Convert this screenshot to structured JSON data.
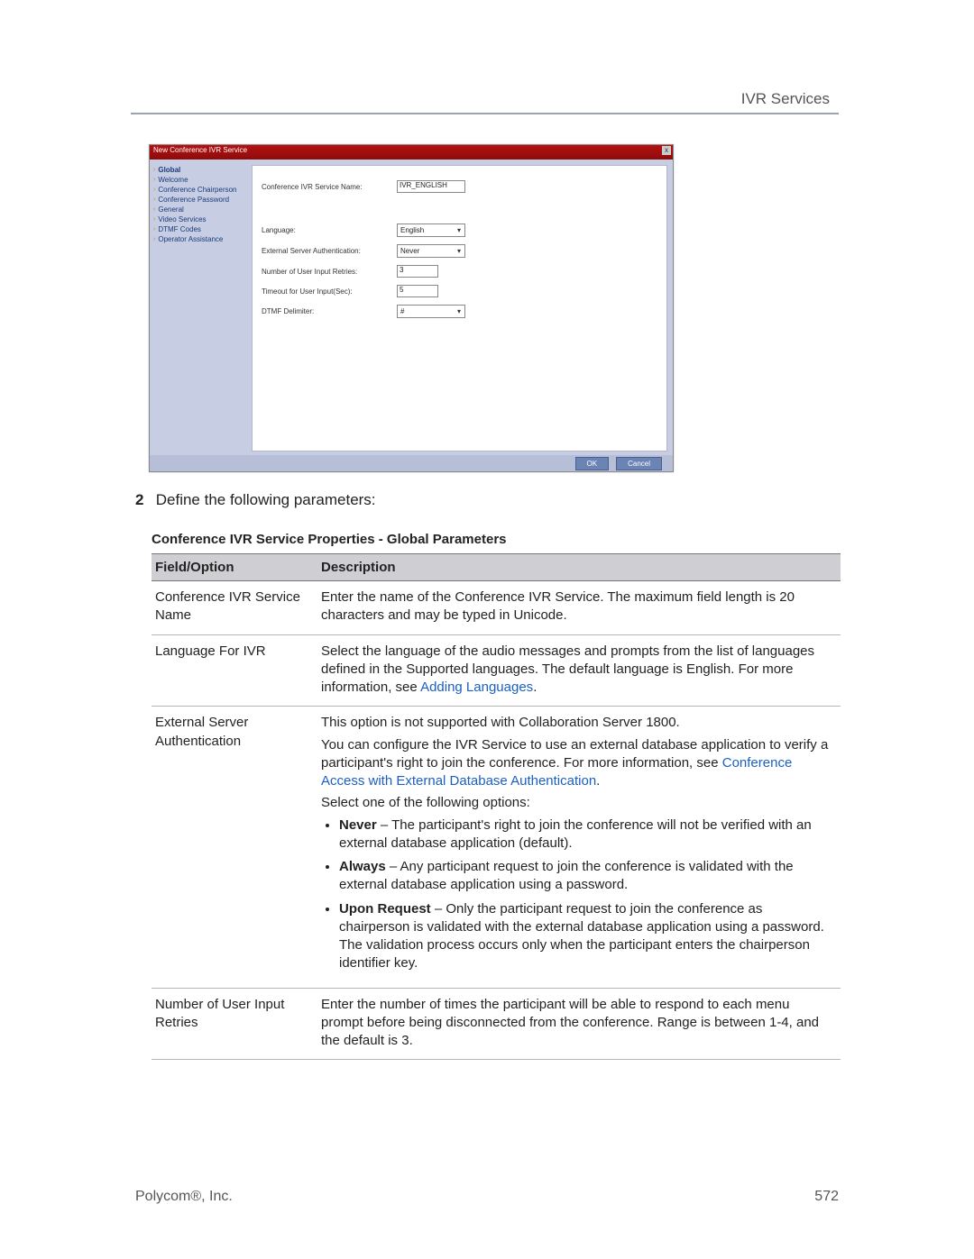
{
  "header": {
    "section": "IVR Services"
  },
  "dialog": {
    "title": "New Conference IVR Service",
    "close_glyph": "x",
    "sidebar": [
      {
        "label": "Global",
        "selected": true
      },
      {
        "label": "Welcome"
      },
      {
        "label": "Conference Chairperson"
      },
      {
        "label": "Conference Password"
      },
      {
        "label": "General"
      },
      {
        "label": "Video Services"
      },
      {
        "label": "DTMF Codes"
      },
      {
        "label": "Operator Assistance"
      }
    ],
    "fields": {
      "service_name": {
        "label": "Conference IVR Service Name:",
        "value": "IVR_ENGLISH"
      },
      "language": {
        "label": "Language:",
        "value": "English"
      },
      "ext_auth": {
        "label": "External Server Authentication:",
        "value": "Never"
      },
      "retries": {
        "label": "Number of User Input Retries:",
        "value": "3"
      },
      "timeout": {
        "label": "Timeout for User Input(Sec):",
        "value": "5"
      },
      "dtmf_delim": {
        "label": "DTMF Delimiter:",
        "value": "#"
      }
    },
    "buttons": {
      "ok": "OK",
      "cancel": "Cancel"
    }
  },
  "step": {
    "num": "2",
    "text": "Define the following parameters:"
  },
  "table": {
    "title": "Conference IVR Service Properties - Global Parameters",
    "head_field": "Field/Option",
    "head_desc": "Description",
    "rows": {
      "r1": {
        "field": "Conference IVR Service Name",
        "desc": "Enter the name of the Conference IVR Service. The maximum field length is 20 characters and may be typed in Unicode."
      },
      "r2": {
        "field": "Language For IVR",
        "desc_a": "Select the language of the audio messages and prompts from the list of languages defined in the Supported languages. The default language is English. For more information, see ",
        "link": "Adding Languages",
        "desc_b": "."
      },
      "r3": {
        "field": "External Server Authentication",
        "p1": "This option is not supported with Collaboration Server 1800.",
        "p2a": "You can configure the IVR Service to use an external database application to verify a participant's right to join the conference. For more information, see ",
        "p2link": "Conference Access with External Database Authentication",
        "p2b": ".",
        "p3": "Select one of the following options:",
        "b1_strong": "Never",
        "b1": " – The participant's right to join the conference will not be verified with an external database application (default).",
        "b2_strong": "Always",
        "b2": " – Any participant request to join the conference is validated with the external database application using a password.",
        "b3_strong": "Upon Request",
        "b3": " – Only the participant request to join the conference as chairperson is validated with the external database application using a password. The validation process occurs only when the participant enters the chairperson identifier key."
      },
      "r4": {
        "field": "Number of User Input Retries",
        "desc": "Enter the number of times the participant will be able to respond to each menu prompt before being disconnected from the conference. Range is between 1-4, and the default is 3."
      }
    }
  },
  "footer": {
    "company": "Polycom®, Inc.",
    "page": "572"
  }
}
